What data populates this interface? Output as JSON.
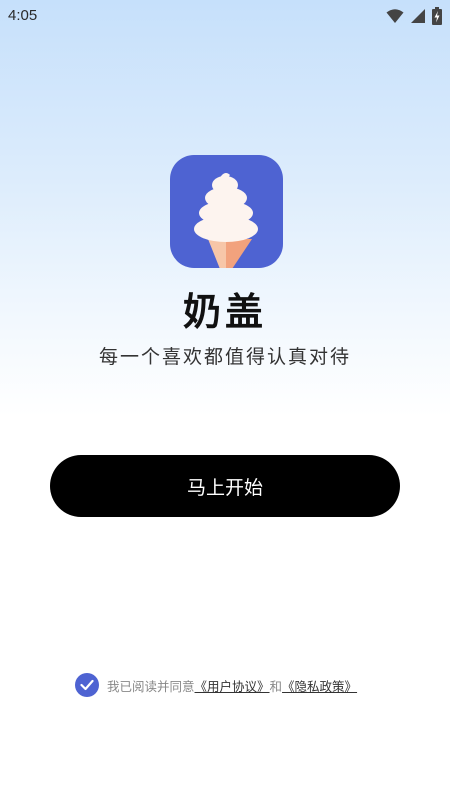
{
  "status_bar": {
    "time": "4:05",
    "icons": [
      "wifi-icon",
      "signal-icon",
      "battery-charging-icon"
    ]
  },
  "app": {
    "logo_icon": "ice-cream-logo-icon",
    "name": "奶盖",
    "slogan": "每一个喜欢都值得认真对待"
  },
  "actions": {
    "start_label": "马上开始"
  },
  "agreement": {
    "checked": true,
    "prefix": "我已阅读并同意",
    "user_agreement": "《用户协议》",
    "conjunction": "和",
    "privacy_policy": "《隐私政策》"
  },
  "colors": {
    "brand": "#4e63d2",
    "button": "#000000",
    "cone_left": "#f7c6a8",
    "cone_right": "#f2a27d",
    "cream": "#fdf4ef"
  }
}
